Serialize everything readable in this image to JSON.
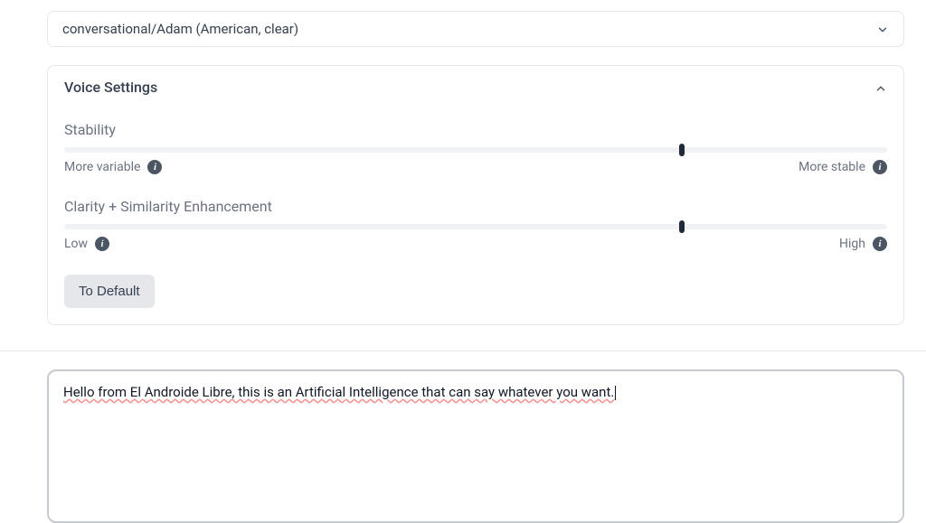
{
  "voice_dropdown": {
    "selected": "conversational/Adam (American, clear)"
  },
  "voice_settings": {
    "title": "Voice Settings",
    "stability": {
      "label": "Stability",
      "left_label": "More variable",
      "right_label": "More stable",
      "value_pct": 75
    },
    "clarity": {
      "label": "Clarity + Similarity Enhancement",
      "left_label": "Low",
      "right_label": "High",
      "value_pct": 75
    },
    "default_button": "To Default"
  },
  "text_input": {
    "value": "Hello from El Androide Libre, this is an Artificial Intelligence that can say whatever you want."
  }
}
